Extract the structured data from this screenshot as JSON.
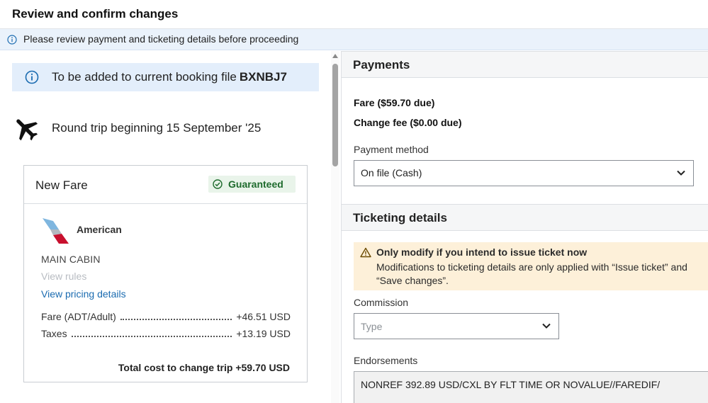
{
  "header": {
    "title": "Review and confirm changes"
  },
  "banner": {
    "text": "Please review payment and ticketing details before proceeding",
    "icon": "info-icon"
  },
  "booking": {
    "text": "To be added to current booking file",
    "code": "BXNBJ7"
  },
  "trip": {
    "text": "Round trip beginning 15 September '25",
    "icon": "plane-icon"
  },
  "fare_card": {
    "title": "New Fare",
    "badge": "Guaranteed",
    "airline": "American",
    "cabin": "MAIN CABIN",
    "view_rules": "View rules",
    "view_pricing": "View pricing details",
    "lines": [
      {
        "label": "Fare (ADT/Adult)",
        "amount": "+46.51 USD"
      },
      {
        "label": "Taxes",
        "amount": "+13.19 USD"
      }
    ],
    "total": "Total cost to change trip +59.70 USD"
  },
  "payments": {
    "title": "Payments",
    "fare_due": "Fare ($59.70 due)",
    "change_fee": "Change fee ($0.00 due)",
    "method_label": "Payment method",
    "method_value": "On file (Cash)"
  },
  "ticketing": {
    "title": "Ticketing details",
    "warning_title": "Only modify if you intend to issue ticket now",
    "warning_body": "Modifications to ticketing details are only applied with “Issue ticket” and “Save changes”.",
    "commission_label": "Commission",
    "commission_placeholder": "Type",
    "endorsements_label": "Endorsements",
    "endorsements_value": "NONREF 392.89 USD/CXL BY FLT TIME OR NOVALUE//FAREDIF/"
  },
  "colors": {
    "link": "#1a6bb0",
    "info_bg": "#e3eefb",
    "success": "#1e6b2d",
    "warning_bg": "#fdf0d9"
  }
}
